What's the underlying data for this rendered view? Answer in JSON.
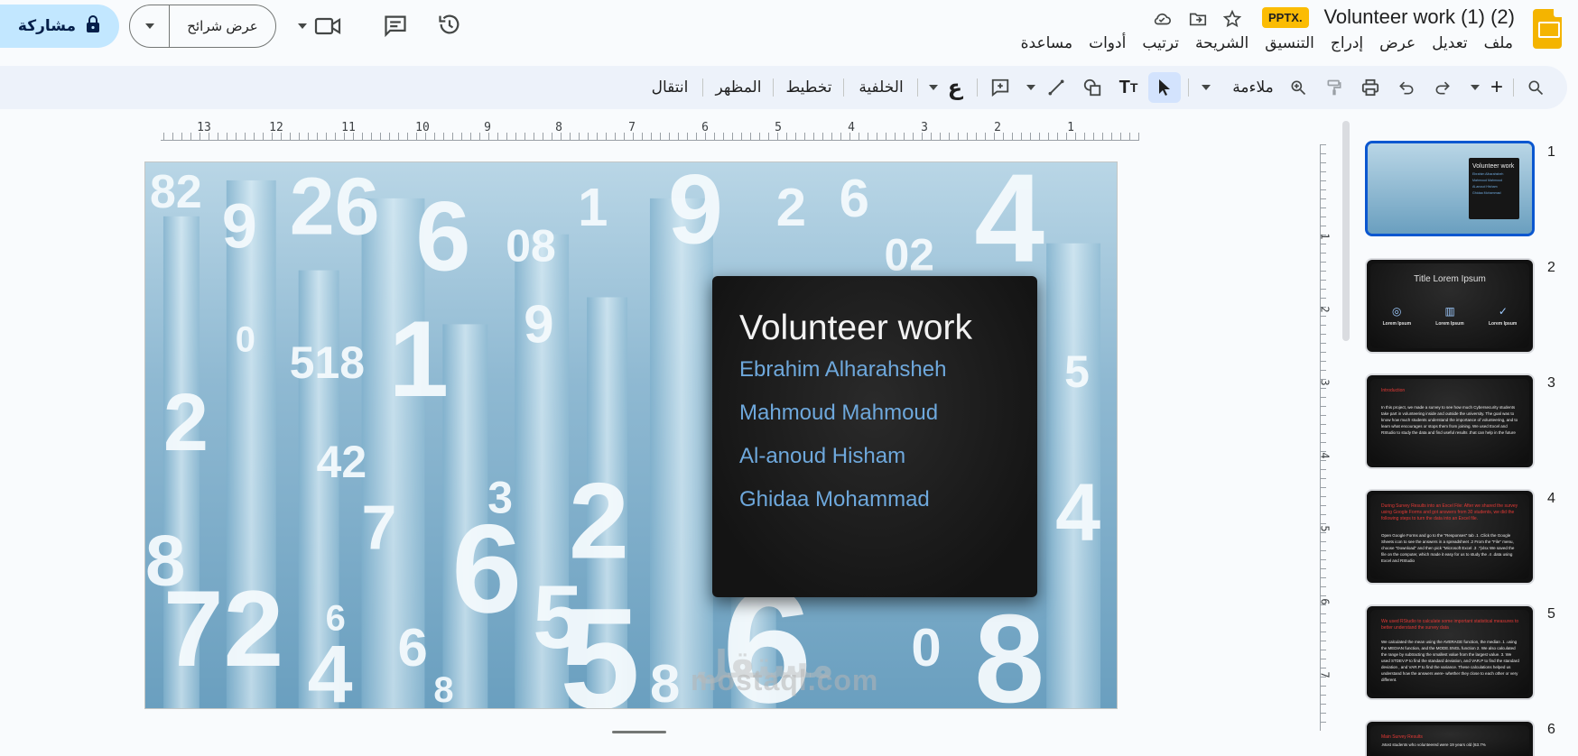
{
  "header": {
    "doc_title": "Volunteer work (1) (2)",
    "file_badge": "PPTX.",
    "share_label": "مشاركة",
    "slideshow_label": "عرض شرائح"
  },
  "menu": [
    "ملف",
    "تعديل",
    "عرض",
    "إدراج",
    "التنسيق",
    "الشريحة",
    "ترتيب",
    "أدوات",
    "مساعدة"
  ],
  "toolbar": {
    "zoom_label": "ملاءمة",
    "background_label": "الخلفية",
    "layout_label": "تخطيط",
    "theme_label": "المظهر",
    "transition_label": "انتقال"
  },
  "ruler": {
    "h_numbers": [
      "1",
      "2",
      "3",
      "4",
      "5",
      "6",
      "7",
      "8",
      "9",
      "10",
      "11",
      "12",
      "13"
    ],
    "v_numbers": [
      "1",
      "2",
      "3",
      "4",
      "5",
      "6",
      "7"
    ]
  },
  "slide": {
    "title": "Volunteer work",
    "names": [
      "Ebrahim Alharahsheh",
      "Mahmoud Mahmoud",
      "Al-anoud Hisham",
      "Ghidaa Mohammad"
    ],
    "watermark_latin": "mostaql.com",
    "watermark_arabic": "مستقل"
  },
  "thumbnails": {
    "numbers": [
      "1",
      "2",
      "3",
      "4",
      "5",
      "6"
    ],
    "t1_title": "Volunteer work",
    "t1_names": [
      "Ebrahim Alharahsheh",
      "Mahmoud Mahmoud",
      "Al-anoud Hisham",
      "Ghidaa Mohammad"
    ],
    "t2_title": "Title Lorem Ipsum",
    "t2_labels": [
      "Lorem Ipsum",
      "Lorem Ipsum",
      "Lorem Ipsum"
    ],
    "t3_heading": "Introduction",
    "t3_body": "In this project, we made a survey to see how much Cybersecurity students take part in volunteering inside and outside the university. The goal was to know how much students understand the importance of volunteering, and to learn what encourages or stops them from joining. We used Excel and RStudio to study the data and find useful results .that can help in the future",
    "t4_heading": "During Survey Results into an Excel File: After we shared the survey using Google Forms and got answers from 30 students, we did the following steps to turn the data into an Excel file.",
    "t4_body": "Open Google Forms and go to the \"Responses\" tab .1 .Click the Google Sheets icon to see the answers in a spreadsheet .2 From the \"File\" menu, choose \"Download\" and then pick \"Microsoft Excel .3 .\"(xlsx We saved the file on the computer, which made it easy for us to study the .4 .data using Excel and RStudio",
    "t5_heading": "We used RStudio to calculate some important statistical measures to better understand the survey data",
    "t5_body": "We calculated the mean using the AVERAGE function, the median .1 .using the MEDIAN function, and the MODE.SNGL function 2. We also calculated the range by subtracting the smallest value from the largest value. 3. We used STDEV.P to find the standard deviation, and VAR.P to find the standard deviation , and VAR.P to find the variance. These calculations helped us understand how the answers were- whether they close to each other or very different.",
    "t6_heading": "Main Survey Results",
    "t6_body": ".Most students who volunteered were 19 years old (63.7%"
  },
  "colors": {
    "accent": "#0b57d0",
    "share_bg": "#c2e7ff",
    "badge": "#fbbc04",
    "slide_name_blue": "#6ea8dc",
    "thumb_red": "#e53935"
  }
}
